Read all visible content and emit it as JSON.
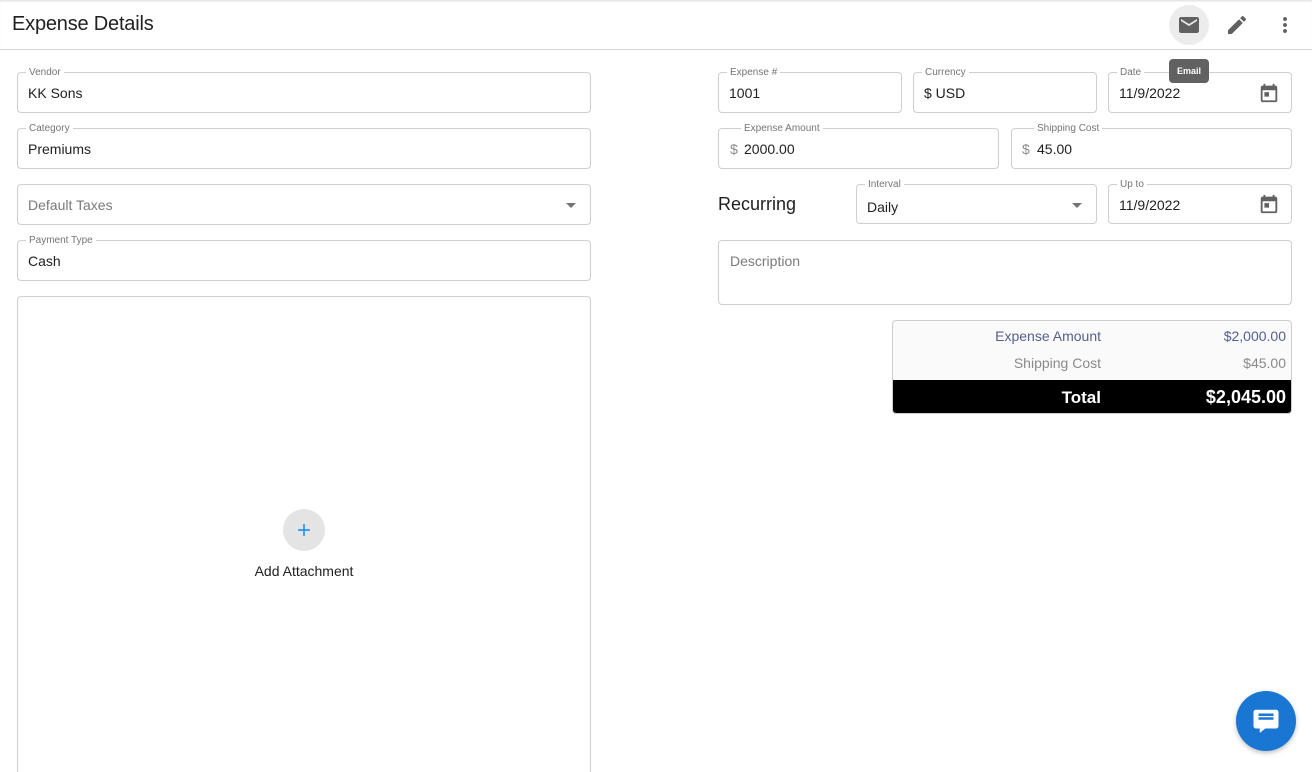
{
  "header": {
    "title": "Expense Details",
    "email_tooltip": "Email",
    "icons": {
      "email": "email-icon",
      "edit": "pencil-icon",
      "more": "more-vert-icon"
    }
  },
  "left": {
    "vendor": {
      "label": "Vendor",
      "value": "KK Sons"
    },
    "category": {
      "label": "Category",
      "value": "Premiums"
    },
    "default_taxes": {
      "placeholder": "Default Taxes"
    },
    "payment_type": {
      "label": "Payment Type",
      "value": "Cash"
    },
    "attachment": {
      "label": "Add Attachment"
    }
  },
  "right": {
    "expense_number": {
      "label": "Expense #",
      "value": "1001"
    },
    "currency": {
      "label": "Currency",
      "value": "$ USD"
    },
    "date": {
      "label": "Date",
      "value": "11/9/2022"
    },
    "expense_amount": {
      "label": "Expense Amount",
      "prefix": "$",
      "value": "2000.00"
    },
    "shipping_cost": {
      "label": "Shipping Cost",
      "prefix": "$",
      "value": "45.00"
    },
    "recurring_label": "Recurring",
    "interval": {
      "label": "Interval",
      "value": "Daily"
    },
    "up_to": {
      "label": "Up to",
      "value": "11/9/2022"
    },
    "description": {
      "placeholder": "Description"
    }
  },
  "totals": {
    "expense_amount_label": "Expense Amount",
    "expense_amount_value": "$2,000.00",
    "shipping_cost_label": "Shipping Cost",
    "shipping_cost_value": "$45.00",
    "total_label": "Total",
    "total_value": "$2,045.00"
  },
  "colors": {
    "accent": "#1976d2",
    "plus": "#2196f3",
    "total_bar": "#000000"
  }
}
